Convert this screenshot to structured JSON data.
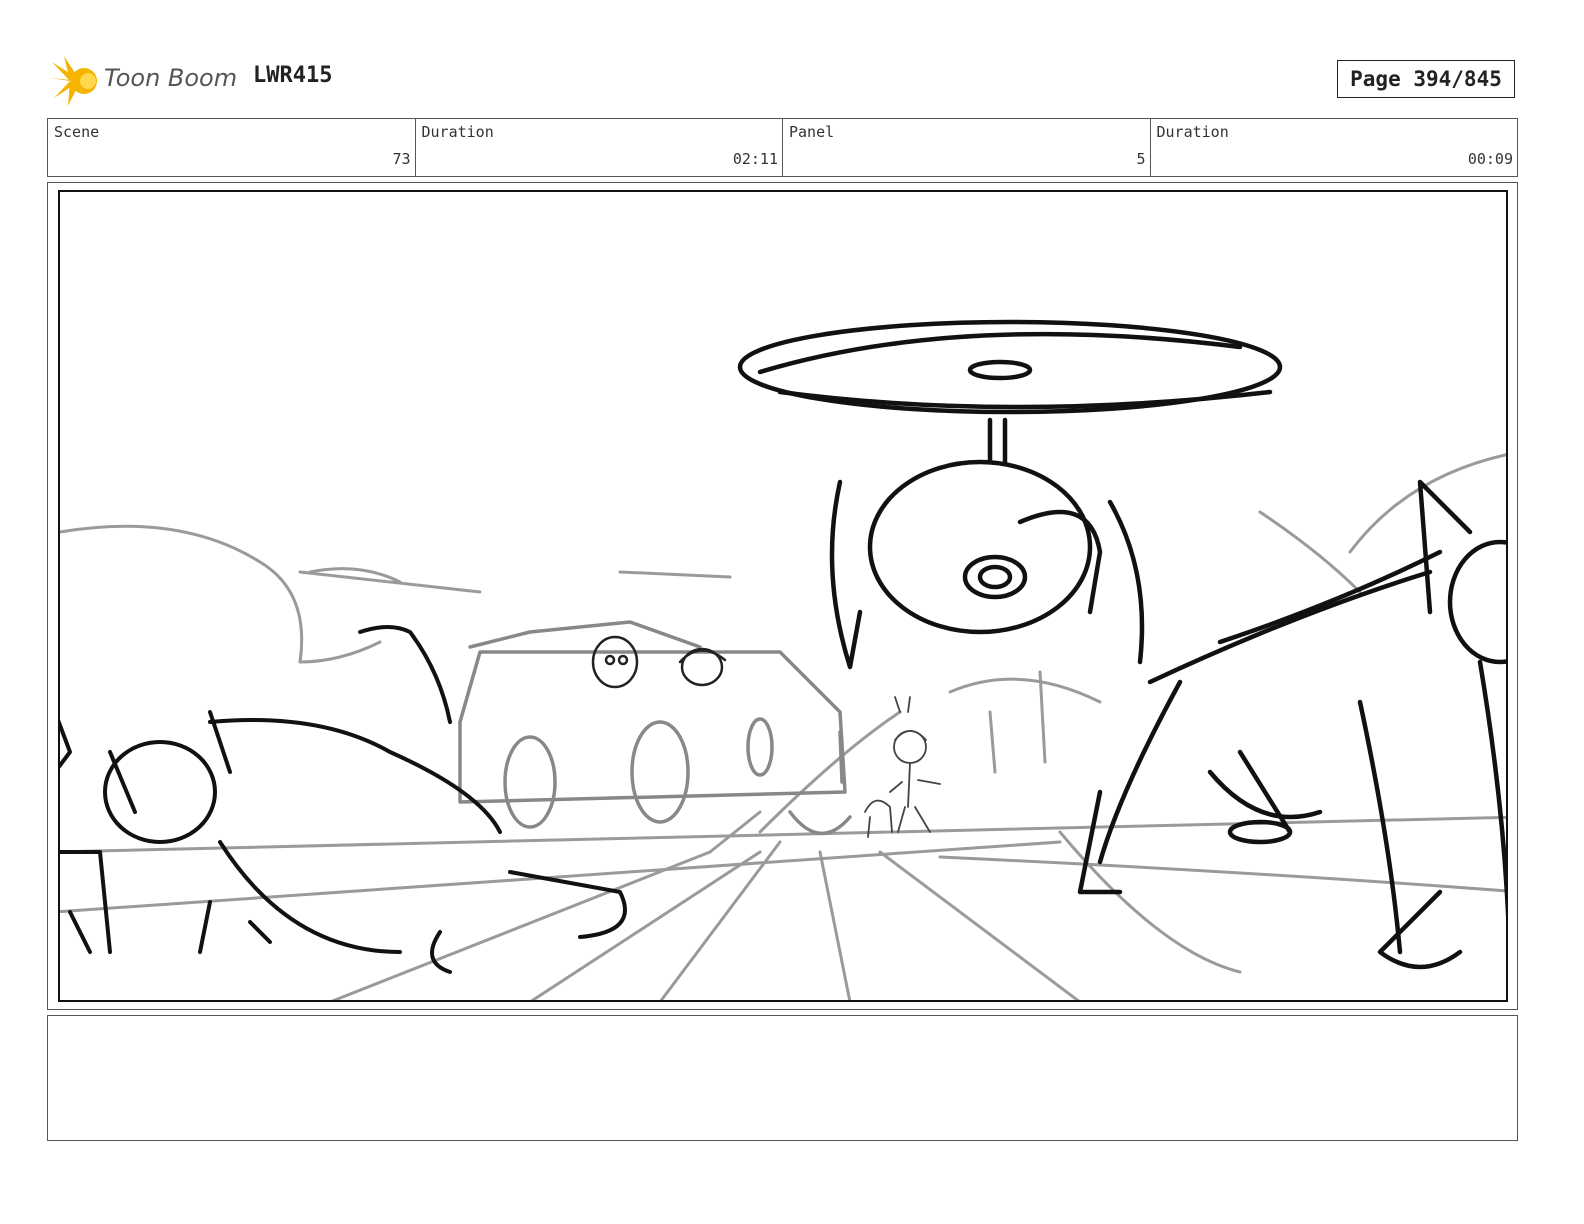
{
  "header": {
    "logo_text": "Toon Boom",
    "project_code": "LWR415",
    "page_label": "Page 394/845"
  },
  "info_table": {
    "cells": [
      {
        "label": "Scene",
        "value": "73"
      },
      {
        "label": "Duration",
        "value": "02:11"
      },
      {
        "label": "Panel",
        "value": "5"
      },
      {
        "label": "Duration",
        "value": "00:09"
      }
    ]
  },
  "panel": {
    "description": ""
  },
  "notes": {
    "text": ""
  },
  "colors": {
    "logo_accent": "#f5b400",
    "sketch_dark": "#111111",
    "sketch_light": "#999999"
  }
}
